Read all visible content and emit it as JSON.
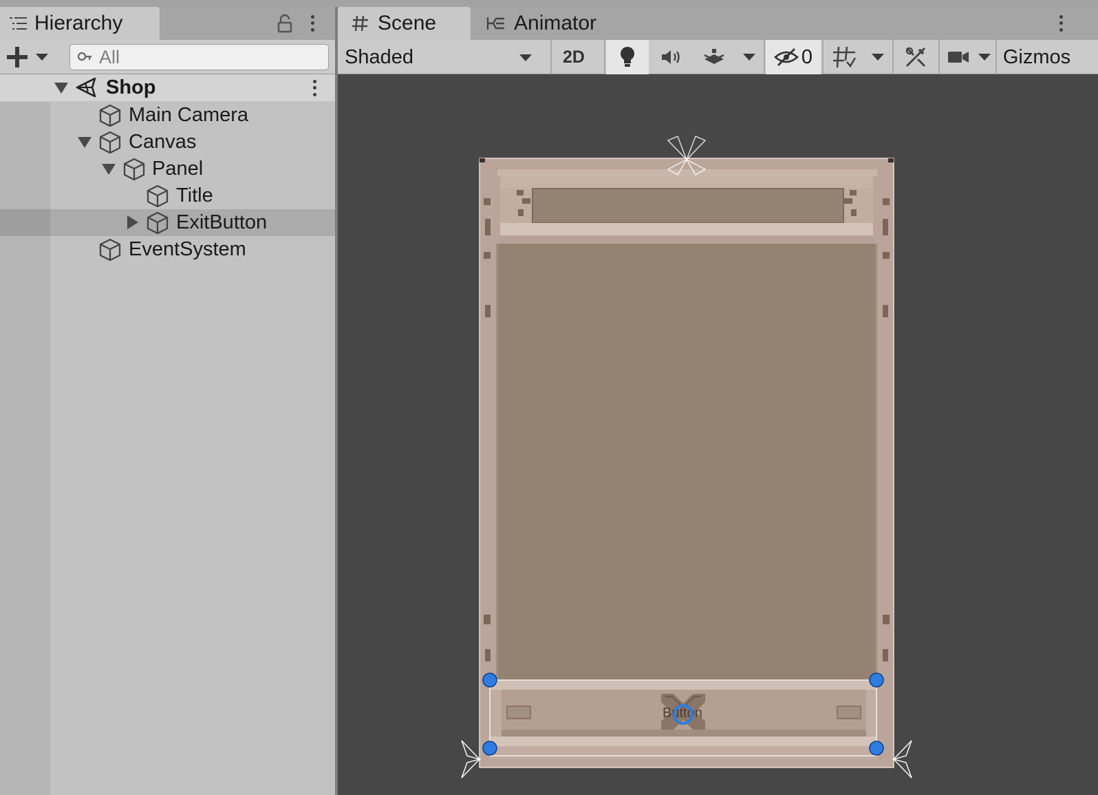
{
  "hierarchy": {
    "tab_label": "Hierarchy",
    "search_placeholder": "All",
    "scene_name": "Shop",
    "items": [
      {
        "label": "Main Camera"
      },
      {
        "label": "Canvas"
      },
      {
        "label": "Panel"
      },
      {
        "label": "Title"
      },
      {
        "label": "ExitButton"
      },
      {
        "label": "EventSystem"
      }
    ],
    "selected_item": "ExitButton"
  },
  "scene_view": {
    "tabs": [
      {
        "label": "Scene",
        "icon": "hash-icon",
        "active": true
      },
      {
        "label": "Animator",
        "icon": "animator-icon",
        "active": false
      }
    ],
    "toolbar": {
      "shading_mode": "Shaded",
      "mode_2d_label": "2D",
      "hidden_count": "0",
      "gizmos_label": "Gizmos"
    },
    "button_text": "Button"
  },
  "colors": {
    "panel_bg": "#c2c2c2",
    "viewport_bg": "#474747",
    "ui_frame": "#bba59a",
    "ui_fill": "#948272",
    "handle_blue": "#2e7de0"
  }
}
